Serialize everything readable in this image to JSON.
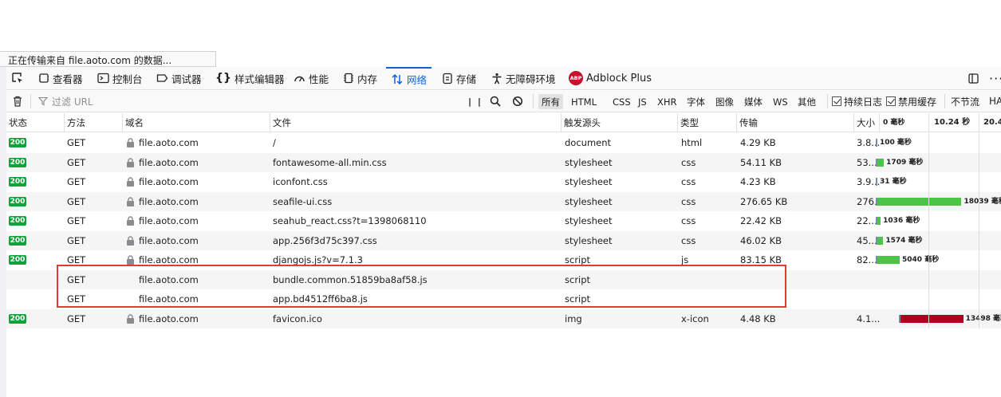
{
  "status_bar": {
    "text": "正在传输来自 file.aoto.com 的数据..."
  },
  "toolbar": {
    "tabs": [
      {
        "label": "查看器",
        "icon": "inspector-icon"
      },
      {
        "label": "控制台",
        "icon": "console-icon"
      },
      {
        "label": "调试器",
        "icon": "debugger-icon"
      },
      {
        "label": "样式编辑器",
        "icon": "style-editor-icon"
      },
      {
        "label": "性能",
        "icon": "performance-icon"
      },
      {
        "label": "内存",
        "icon": "memory-icon"
      },
      {
        "label": "网络",
        "icon": "network-icon"
      },
      {
        "label": "存储",
        "icon": "storage-icon"
      },
      {
        "label": "无障碍环境",
        "icon": "accessibility-icon"
      },
      {
        "label": "Adblock Plus",
        "icon": "adblock-plus-icon",
        "badge": "ABP"
      }
    ],
    "active_tab": "网络"
  },
  "filter": {
    "placeholder": "过滤 URL",
    "types": [
      "所有",
      "HTML",
      "CSS",
      "JS",
      "XHR",
      "字体",
      "图像",
      "媒体",
      "WS",
      "其他"
    ],
    "selected_type": "所有",
    "persist_logs": "持续日志",
    "disable_cache": "禁用缓存",
    "throttle": "不节流",
    "har": "HA"
  },
  "table": {
    "columns": [
      "状态",
      "方法",
      "域名",
      "文件",
      "触发源头",
      "类型",
      "传输",
      "大小"
    ],
    "timeline_ticks": [
      "0 毫秒",
      "10.24 秒",
      "20.4"
    ],
    "rows": [
      {
        "status": "200",
        "method": "GET",
        "domain": "file.aoto.com",
        "file": "/",
        "cause": "document",
        "type": "html",
        "transferred": "4.29 KB",
        "size": "3.8...",
        "timing": "100 毫秒",
        "wf_start": 0,
        "wf_dur": 100,
        "wf_color": "#4cc447"
      },
      {
        "status": "200",
        "method": "GET",
        "domain": "file.aoto.com",
        "file": "fontawesome-all.min.css",
        "cause": "stylesheet",
        "type": "css",
        "transferred": "54.11 KB",
        "size": "53...",
        "timing": "1709 毫秒",
        "wf_start": 0,
        "wf_dur": 1709,
        "wf_color": "#4cc447"
      },
      {
        "status": "200",
        "method": "GET",
        "domain": "file.aoto.com",
        "file": "iconfont.css",
        "cause": "stylesheet",
        "type": "css",
        "transferred": "4.23 KB",
        "size": "3.9...",
        "timing": "31 毫秒",
        "wf_start": 0,
        "wf_dur": 31,
        "wf_color": "#4cc447"
      },
      {
        "status": "200",
        "method": "GET",
        "domain": "file.aoto.com",
        "file": "seafile-ui.css",
        "cause": "stylesheet",
        "type": "css",
        "transferred": "276.65 KB",
        "size": "276...",
        "timing": "18039 毫秒",
        "wf_start": 0,
        "wf_dur": 18039,
        "wf_color": "#4cc447"
      },
      {
        "status": "200",
        "method": "GET",
        "domain": "file.aoto.com",
        "file": "seahub_react.css?t=1398068110",
        "cause": "stylesheet",
        "type": "css",
        "transferred": "22.42 KB",
        "size": "22...",
        "timing": "1036 毫秒",
        "wf_start": 0,
        "wf_dur": 1036,
        "wf_color": "#4cc447"
      },
      {
        "status": "200",
        "method": "GET",
        "domain": "file.aoto.com",
        "file": "app.256f3d75c397.css",
        "cause": "stylesheet",
        "type": "css",
        "transferred": "46.02 KB",
        "size": "45...",
        "timing": "1574 毫秒",
        "wf_start": 0,
        "wf_dur": 1574,
        "wf_color": "#4cc447"
      },
      {
        "status": "200",
        "method": "GET",
        "domain": "file.aoto.com",
        "file": "djangojs.js?v=7.1.3",
        "cause": "script",
        "type": "js",
        "transferred": "83.15 KB",
        "size": "82...",
        "timing": "5040 毫秒",
        "wf_start": 0,
        "wf_dur": 5040,
        "wf_color": "#4cc447"
      },
      {
        "status": "",
        "method": "GET",
        "domain": "file.aoto.com",
        "file": "bundle.common.51859ba8af58.js",
        "cause": "script",
        "type": "",
        "transferred": "",
        "size": "",
        "timing": ""
      },
      {
        "status": "",
        "method": "GET",
        "domain": "file.aoto.com",
        "file": "app.bd4512ff6ba8.js",
        "cause": "script",
        "type": "",
        "transferred": "",
        "size": "",
        "timing": ""
      },
      {
        "status": "200",
        "method": "GET",
        "domain": "file.aoto.com",
        "file": "favicon.ico",
        "cause": "img",
        "type": "x-icon",
        "transferred": "4.48 KB",
        "size": "4.1...",
        "timing": "13498 毫秒",
        "wf_start": 4900,
        "wf_dur": 13498,
        "wf_color": "#b00020"
      }
    ]
  },
  "colors": {
    "accent": "#0a64d8",
    "status_ok": "#12a23b",
    "highlight": "#e53935"
  }
}
